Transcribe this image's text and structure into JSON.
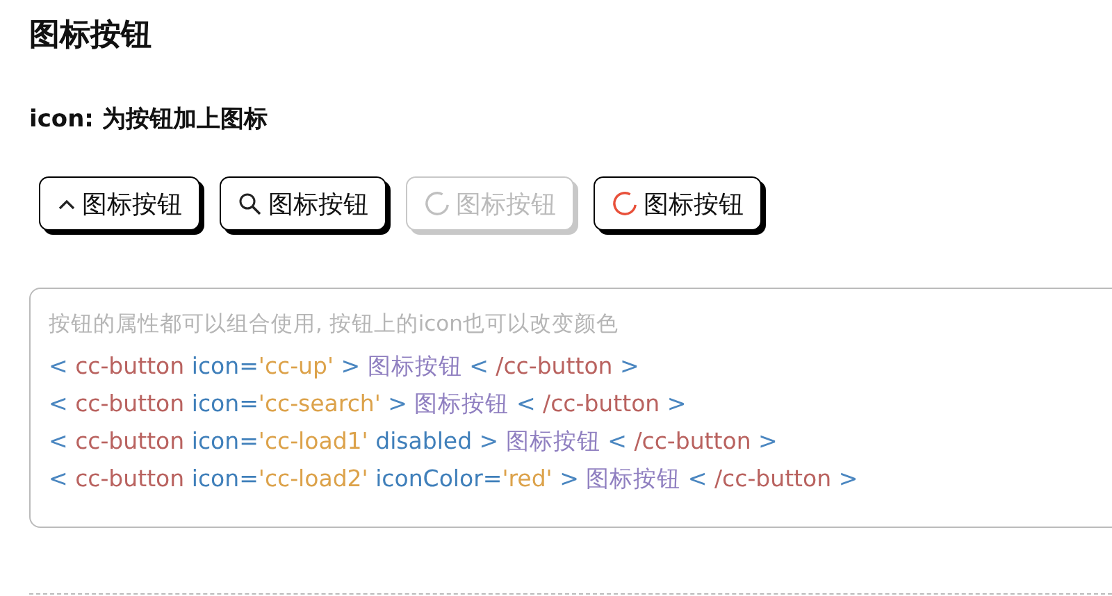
{
  "title": "图标按钮",
  "subtitle": "icon: 为按钮加上图标",
  "buttons": [
    {
      "label": "图标按钮",
      "kind": "chevron",
      "disabled": false,
      "color": "#222222"
    },
    {
      "label": "图标按钮",
      "kind": "magnifier",
      "disabled": false,
      "color": "#222222"
    },
    {
      "label": "图标按钮",
      "kind": "spinner",
      "disabled": true,
      "color": "#c0c0c0"
    },
    {
      "label": "图标按钮",
      "kind": "spinner",
      "disabled": false,
      "color": "#e8503a"
    }
  ],
  "code": {
    "note": "按钮的属性都可以组合使用, 按钮上的icon也可以改变颜色",
    "lines": [
      [
        {
          "kind": "punct",
          "text": "<"
        },
        {
          "kind": "tag",
          "text": "cc-button"
        },
        {
          "kind": "attr",
          "text": "icon="
        },
        {
          "kind": "string",
          "text": "'cc-up'"
        },
        {
          "kind": "punct",
          "text": ">"
        },
        {
          "kind": "text",
          "text": "图标按钮"
        },
        {
          "kind": "punct",
          "text": "<"
        },
        {
          "kind": "tag",
          "text": "/cc-button"
        },
        {
          "kind": "punct",
          "text": ">"
        }
      ],
      [
        {
          "kind": "punct",
          "text": "<"
        },
        {
          "kind": "tag",
          "text": "cc-button"
        },
        {
          "kind": "attr",
          "text": "icon="
        },
        {
          "kind": "string",
          "text": "'cc-search'"
        },
        {
          "kind": "punct",
          "text": ">"
        },
        {
          "kind": "text",
          "text": "图标按钮"
        },
        {
          "kind": "punct",
          "text": "<"
        },
        {
          "kind": "tag",
          "text": "/cc-button"
        },
        {
          "kind": "punct",
          "text": ">"
        }
      ],
      [
        {
          "kind": "punct",
          "text": "<"
        },
        {
          "kind": "tag",
          "text": "cc-button"
        },
        {
          "kind": "attr",
          "text": "icon="
        },
        {
          "kind": "string",
          "text": "'cc-load1'"
        },
        {
          "kind": "attr",
          "text": "disabled"
        },
        {
          "kind": "punct",
          "text": ">"
        },
        {
          "kind": "text",
          "text": "图标按钮"
        },
        {
          "kind": "punct",
          "text": "<"
        },
        {
          "kind": "tag",
          "text": "/cc-button"
        },
        {
          "kind": "punct",
          "text": ">"
        }
      ],
      [
        {
          "kind": "punct",
          "text": "<"
        },
        {
          "kind": "tag",
          "text": "cc-button"
        },
        {
          "kind": "attr",
          "text": "icon="
        },
        {
          "kind": "string",
          "text": "'cc-load2'"
        },
        {
          "kind": "attr",
          "text": "iconColor="
        },
        {
          "kind": "string",
          "text": "'red'"
        },
        {
          "kind": "punct",
          "text": ">"
        },
        {
          "kind": "text",
          "text": "图标按钮"
        },
        {
          "kind": "punct",
          "text": "<"
        },
        {
          "kind": "tag",
          "text": "/cc-button"
        },
        {
          "kind": "punct",
          "text": ">"
        }
      ]
    ]
  }
}
